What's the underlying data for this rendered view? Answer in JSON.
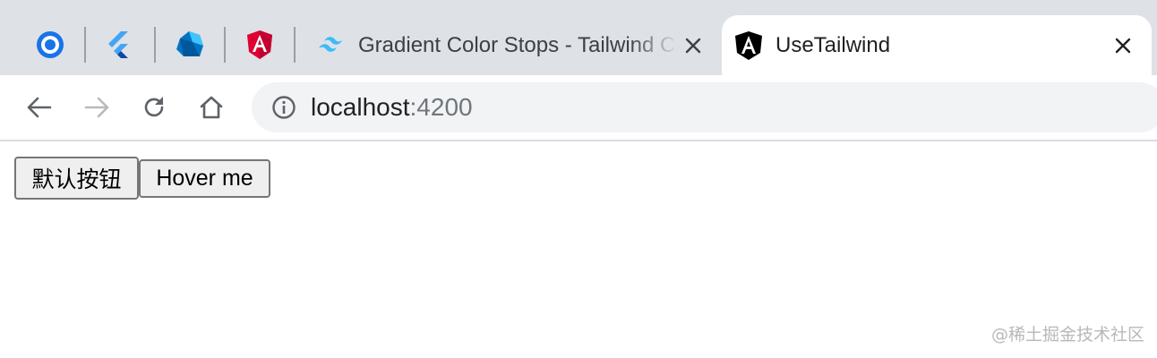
{
  "tabs": {
    "pinned": [
      {
        "name": "record-icon",
        "color": "#1a73e8"
      },
      {
        "name": "flutter-icon",
        "color": "#42a5f5"
      },
      {
        "name": "dart-icon",
        "color": "#0175c2"
      },
      {
        "name": "angular-icon",
        "color": "#dd0031"
      }
    ],
    "inactive": {
      "title": "Gradient Color Stops - Tailwind CSS",
      "icon": "tailwind-icon",
      "color": "#38bdf8"
    },
    "active": {
      "title": "UseTailwind",
      "icon": "angular-black-icon",
      "color": "#000000"
    }
  },
  "toolbar": {
    "url_host": "localhost",
    "url_port": ":4200"
  },
  "page": {
    "buttons": [
      {
        "label": "默认按钮"
      },
      {
        "label": "Hover me"
      }
    ]
  },
  "watermark": "@稀土掘金技术社区"
}
